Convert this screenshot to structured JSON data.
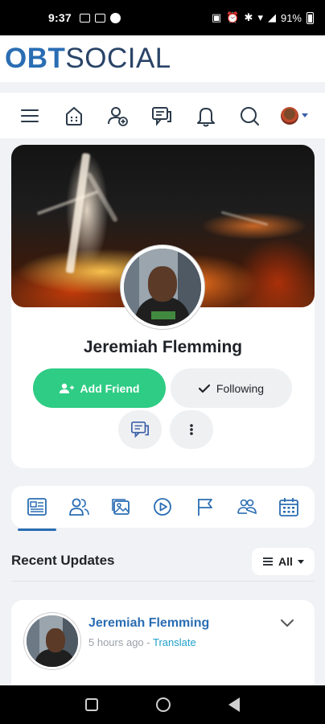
{
  "status_bar": {
    "time": "9:37",
    "battery": "91%"
  },
  "brand": {
    "part1": "OBT",
    "part2": " SOCIAL"
  },
  "nav": {
    "icons": [
      "menu-icon",
      "home-icon",
      "friends-icon",
      "messages-icon",
      "notifications-icon",
      "search-icon",
      "user-avatar"
    ]
  },
  "profile": {
    "name": "Jeremiah Flemming",
    "add_friend_label": "Add Friend",
    "following_label": "Following"
  },
  "tabs": {
    "items": [
      "timeline",
      "friends",
      "photos",
      "videos",
      "pages",
      "groups",
      "events"
    ],
    "active": "timeline"
  },
  "recent": {
    "title": "Recent Updates",
    "filter_label": "All"
  },
  "post": {
    "author": "Jeremiah Flemming",
    "time": "5 hours ago",
    "separator": " - ",
    "translate_label": "Translate"
  },
  "colors": {
    "brand_blue": "#2a6db3",
    "accent_green": "#2ecc84",
    "link_teal": "#1ea1c8",
    "nav_blue": "#3a5fa8"
  }
}
